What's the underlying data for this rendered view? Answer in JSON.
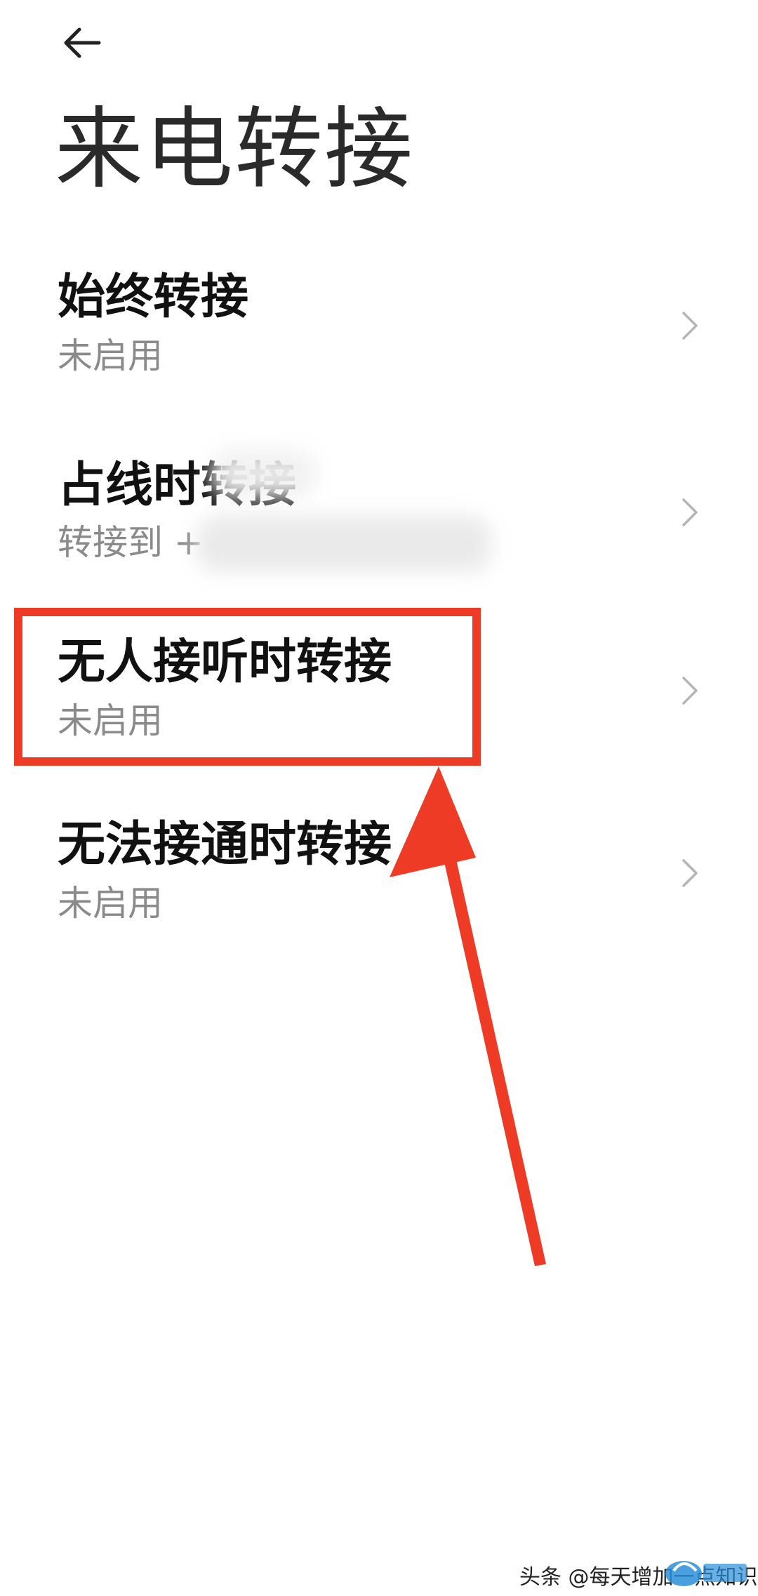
{
  "header": {
    "back_icon": "arrow-left-icon",
    "title": "来电转接"
  },
  "items": [
    {
      "id": "always",
      "title": "始终转接",
      "subtitle": "未启用"
    },
    {
      "id": "busy",
      "title": "占线时转接",
      "subtitle": "转接到 +"
    },
    {
      "id": "no-answer",
      "title": "无人接听时转接",
      "subtitle": "未启用"
    },
    {
      "id": "unreachable",
      "title": "无法接通时转接",
      "subtitle": "未启用"
    }
  ],
  "chevron_icon": "chevron-right-icon",
  "annotation": {
    "highlight_color": "#ee3b26",
    "arrow_color": "#ee3b26"
  },
  "watermark": {
    "text": "头条 @每天增加一点知识"
  }
}
